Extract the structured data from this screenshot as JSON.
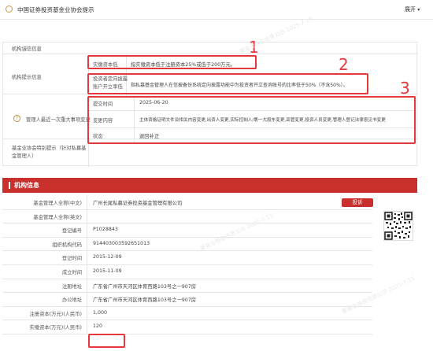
{
  "header": {
    "title": "中国证券投资基金业协会提示",
    "expand_label": "展开",
    "expand_icon": "chevron-down-icon"
  },
  "tips": {
    "rows": [
      {
        "label": "机构诚信信息",
        "value": ""
      },
      {
        "label": "机构提示信息",
        "value": ""
      },
      {
        "label": "管理人最近一次重大事项变更",
        "value": ""
      },
      {
        "label": "基金业协会特别提示（针对私募基金管理人）",
        "value": ""
      }
    ],
    "sub_rows": [
      {
        "label": "实缴资本低",
        "value": "指实缴资本低于注册资本25%或低于200万元。"
      },
      {
        "label": "投资者定向披露账户开立率低",
        "value": "指私募基金管理人在信披备份系统定向披露功能中为投资者开立查询账号的比率低于50%（不含50%）。"
      }
    ],
    "change_rows": [
      {
        "label": "提交时间",
        "value": "2025-06-20"
      },
      {
        "label": "变更内容",
        "value": "主体资格证明文件及相关内容变更,出资人变更,实际控制人/第一大股东变更,高管变更,投资人员变更,管理人登记法律意见书变更"
      },
      {
        "label": "状态",
        "value": "退回补正"
      }
    ],
    "help_icon": "question-circle-icon"
  },
  "annotations": [
    "1",
    "2",
    "3"
  ],
  "org": {
    "section_title": "机构信息",
    "complaint_label": "投诉",
    "rows": [
      {
        "label": "基金管理人全称(中文)",
        "value": "广州长尾私募证券投资基金管理有限公司"
      },
      {
        "label": "基金管理人全称(英文)",
        "value": ""
      },
      {
        "label": "登记编号",
        "value": "P1028843"
      },
      {
        "label": "组织机构代码",
        "value": "914403003592651013"
      },
      {
        "label": "登记时间",
        "value": "2015-12-09"
      },
      {
        "label": "成立时间",
        "value": "2015-11-09"
      },
      {
        "label": "注册地址",
        "value": "广东省广州市天河区体育西路103号之一907房"
      },
      {
        "label": "办公地址",
        "value": "广东省广州市天河区体育西路103号之一907房"
      },
      {
        "label": "注册资本(万元)(人民币)",
        "value": "1,000"
      },
      {
        "label": "实缴资本(万元)(人民币)",
        "value": "120"
      }
    ]
  },
  "watermarks": [
    "基金业协会信息公示 2025-7-15"
  ],
  "colors": {
    "accent": "#c9302c",
    "highlight": "#e5383b"
  }
}
